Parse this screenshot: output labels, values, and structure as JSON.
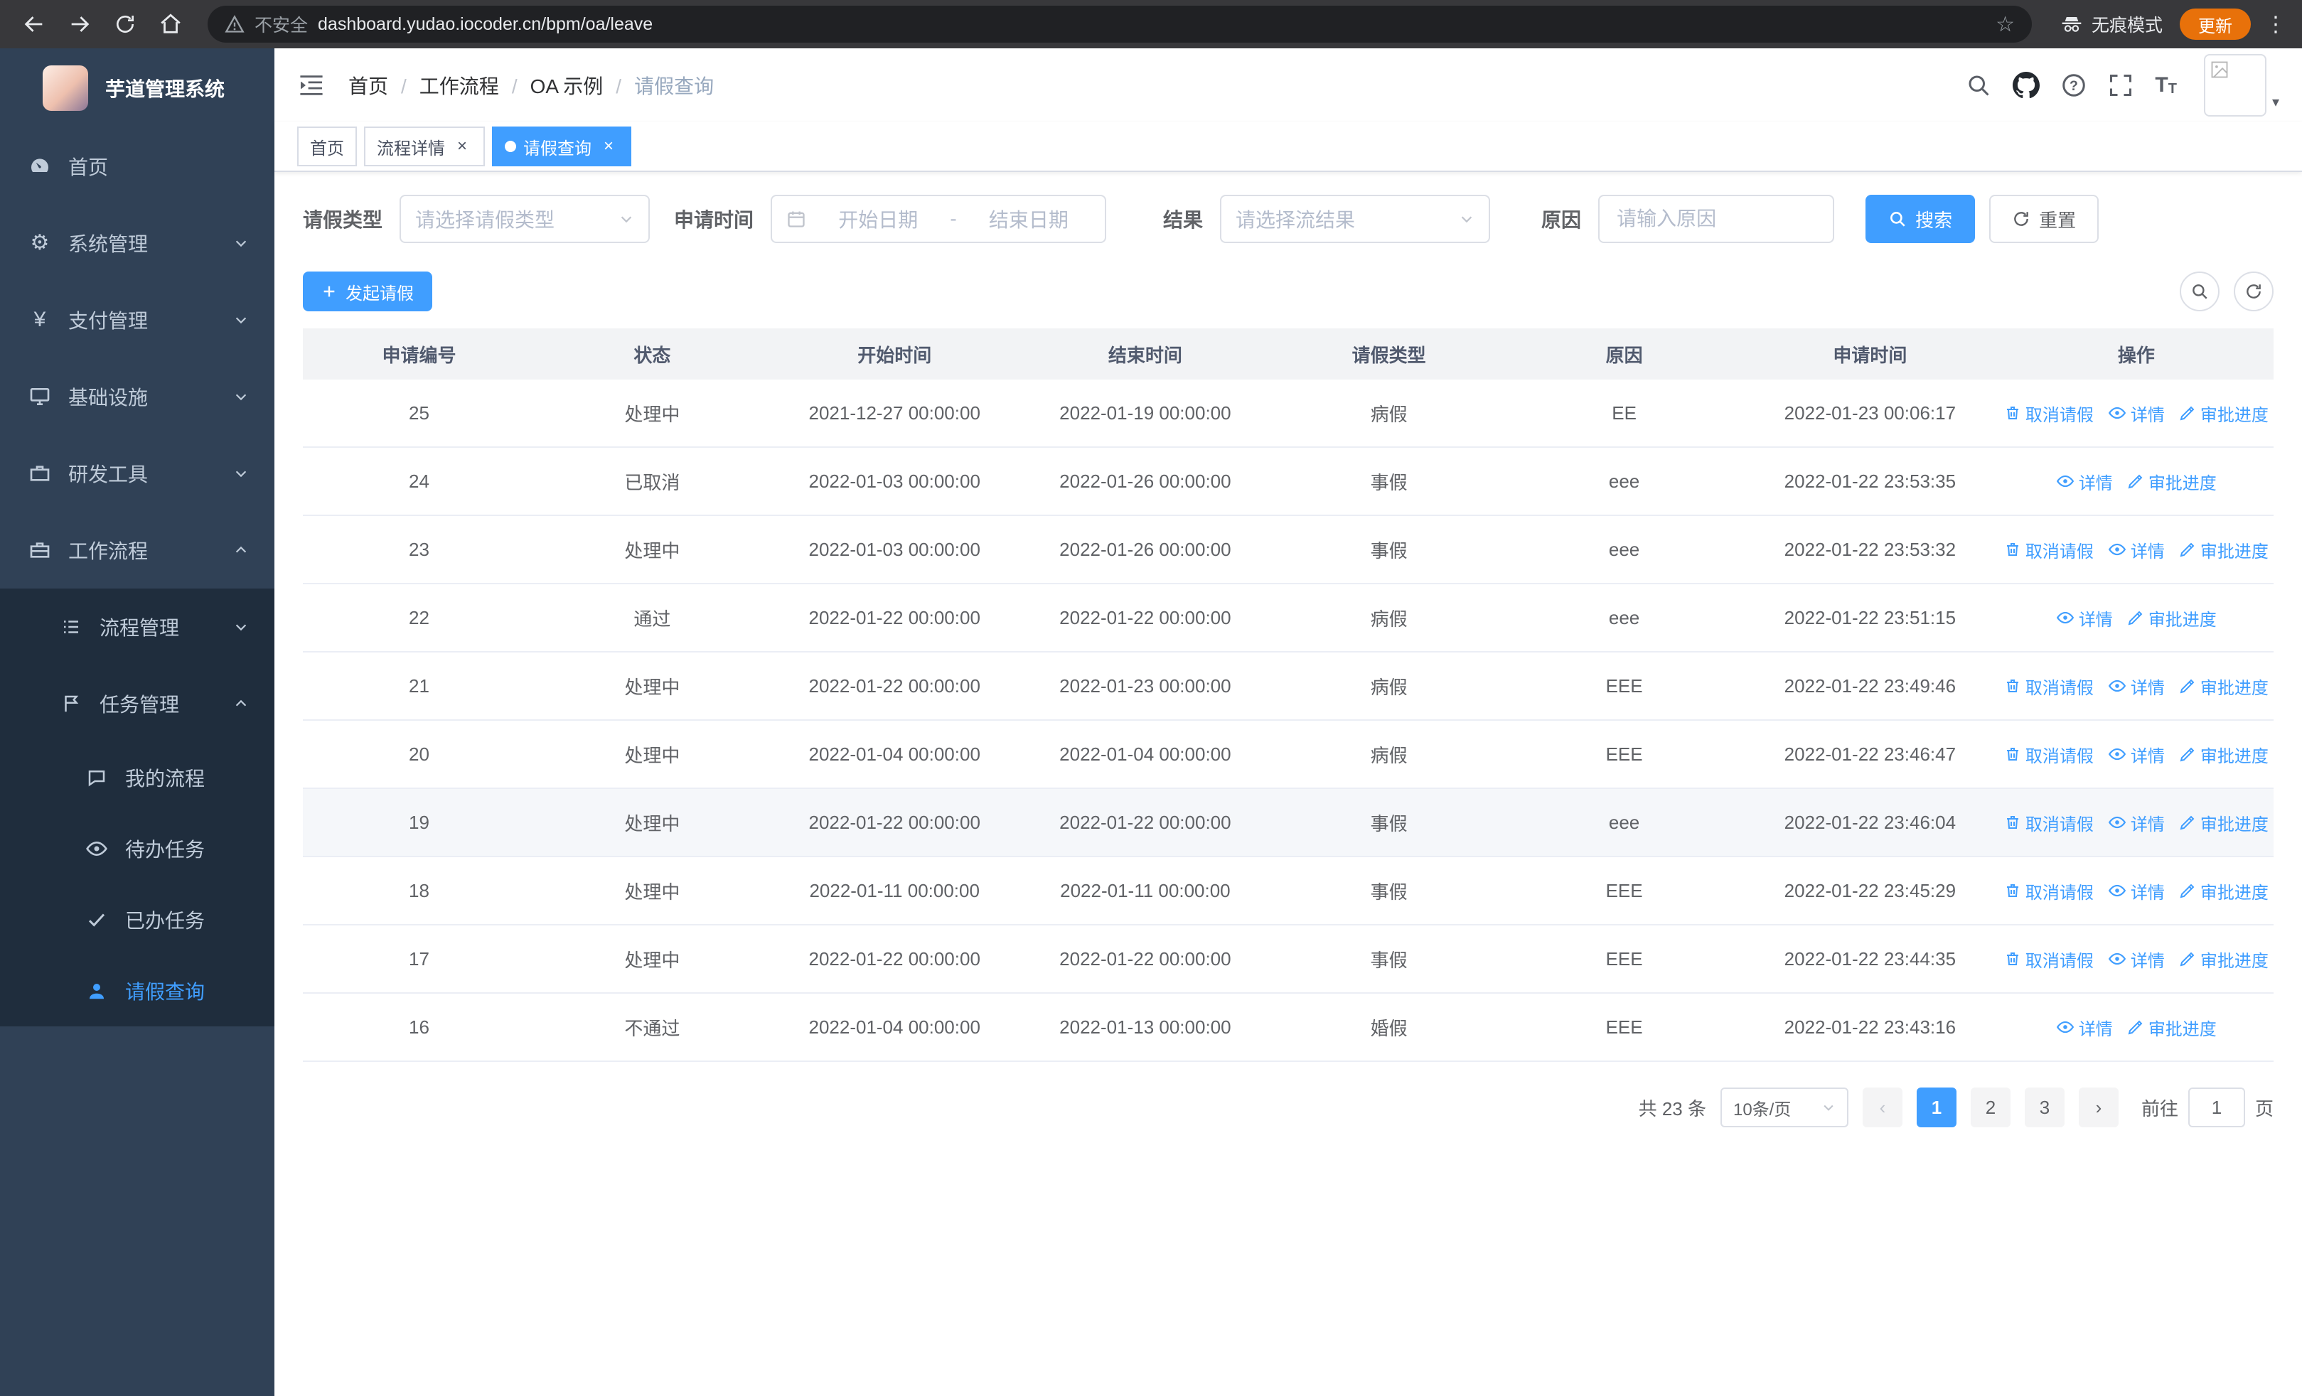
{
  "browser": {
    "url": "dashboard.yudao.iocoder.cn/bpm/oa/leave",
    "security_label": "不安全",
    "incognito_label": "无痕模式",
    "update_label": "更新"
  },
  "icons": {
    "close": "×",
    "star": "☆",
    "menu_dots": "⋮",
    "gear": "⚙",
    "yen": "¥",
    "prev": "‹",
    "next": "›"
  },
  "sidebar": {
    "logo_title": "芋道管理系统",
    "menu": [
      {
        "label": "首页"
      },
      {
        "label": "系统管理"
      },
      {
        "label": "支付管理"
      },
      {
        "label": "基础设施"
      },
      {
        "label": "研发工具"
      },
      {
        "label": "工作流程"
      }
    ],
    "workflow_children": [
      {
        "label": "流程管理"
      },
      {
        "label": "任务管理"
      }
    ],
    "task_children": [
      {
        "label": "我的流程"
      },
      {
        "label": "待办任务"
      },
      {
        "label": "已办任务"
      },
      {
        "label": "请假查询"
      }
    ]
  },
  "header": {
    "breadcrumb": [
      "首页",
      "工作流程",
      "OA 示例",
      "请假查询"
    ]
  },
  "tabs": [
    {
      "label": "首页"
    },
    {
      "label": "流程详情"
    },
    {
      "label": "请假查询"
    }
  ],
  "filters": {
    "leave_type_label": "请假类型",
    "leave_type_placeholder": "请选择请假类型",
    "apply_time_label": "申请时间",
    "start_placeholder": "开始日期",
    "range_separator": "-",
    "end_placeholder": "结束日期",
    "result_label": "结果",
    "result_placeholder": "请选择流结果",
    "reason_label": "原因",
    "reason_placeholder": "请输入原因",
    "search_label": "搜索",
    "reset_label": "重置"
  },
  "toolbar": {
    "create_label": "发起请假"
  },
  "table": {
    "columns": [
      "申请编号",
      "状态",
      "开始时间",
      "结束时间",
      "请假类型",
      "原因",
      "申请时间",
      "操作"
    ],
    "action_labels": {
      "cancel": "取消请假",
      "detail": "详情",
      "progress": "审批进度"
    },
    "rows": [
      {
        "id": "25",
        "status": "处理中",
        "start": "2021-12-27 00:00:00",
        "end": "2022-01-19 00:00:00",
        "type": "病假",
        "reason": "EE",
        "applied": "2022-01-23 00:06:17",
        "actions": [
          "cancel",
          "detail",
          "progress"
        ]
      },
      {
        "id": "24",
        "status": "已取消",
        "start": "2022-01-03 00:00:00",
        "end": "2022-01-26 00:00:00",
        "type": "事假",
        "reason": "eee",
        "applied": "2022-01-22 23:53:35",
        "actions": [
          "detail",
          "progress"
        ]
      },
      {
        "id": "23",
        "status": "处理中",
        "start": "2022-01-03 00:00:00",
        "end": "2022-01-26 00:00:00",
        "type": "事假",
        "reason": "eee",
        "applied": "2022-01-22 23:53:32",
        "actions": [
          "cancel",
          "detail",
          "progress"
        ]
      },
      {
        "id": "22",
        "status": "通过",
        "start": "2022-01-22 00:00:00",
        "end": "2022-01-22 00:00:00",
        "type": "病假",
        "reason": "eee",
        "applied": "2022-01-22 23:51:15",
        "actions": [
          "detail",
          "progress"
        ]
      },
      {
        "id": "21",
        "status": "处理中",
        "start": "2022-01-22 00:00:00",
        "end": "2022-01-23 00:00:00",
        "type": "病假",
        "reason": "EEE",
        "applied": "2022-01-22 23:49:46",
        "actions": [
          "cancel",
          "detail",
          "progress"
        ]
      },
      {
        "id": "20",
        "status": "处理中",
        "start": "2022-01-04 00:00:00",
        "end": "2022-01-04 00:00:00",
        "type": "病假",
        "reason": "EEE",
        "applied": "2022-01-22 23:46:47",
        "actions": [
          "cancel",
          "detail",
          "progress"
        ]
      },
      {
        "id": "19",
        "status": "处理中",
        "start": "2022-01-22 00:00:00",
        "end": "2022-01-22 00:00:00",
        "type": "事假",
        "reason": "eee",
        "applied": "2022-01-22 23:46:04",
        "actions": [
          "cancel",
          "detail",
          "progress"
        ],
        "highlighted": true
      },
      {
        "id": "18",
        "status": "处理中",
        "start": "2022-01-11 00:00:00",
        "end": "2022-01-11 00:00:00",
        "type": "事假",
        "reason": "EEE",
        "applied": "2022-01-22 23:45:29",
        "actions": [
          "cancel",
          "detail",
          "progress"
        ]
      },
      {
        "id": "17",
        "status": "处理中",
        "start": "2022-01-22 00:00:00",
        "end": "2022-01-22 00:00:00",
        "type": "事假",
        "reason": "EEE",
        "applied": "2022-01-22 23:44:35",
        "actions": [
          "cancel",
          "detail",
          "progress"
        ]
      },
      {
        "id": "16",
        "status": "不通过",
        "start": "2022-01-04 00:00:00",
        "end": "2022-01-13 00:00:00",
        "type": "婚假",
        "reason": "EEE",
        "applied": "2022-01-22 23:43:16",
        "actions": [
          "detail",
          "progress"
        ]
      }
    ]
  },
  "pagination": {
    "total_label": "共 23 条",
    "page_size_label": "10条/页",
    "pages": [
      "1",
      "2",
      "3"
    ],
    "active_page": "1",
    "goto_label": "前往",
    "goto_value": "1",
    "unit_label": "页"
  }
}
